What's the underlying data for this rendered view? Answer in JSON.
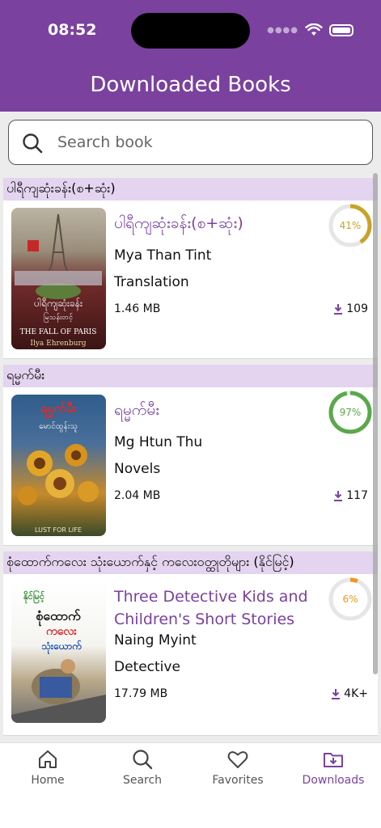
{
  "status": {
    "time": "08:52"
  },
  "header": {
    "title": "Downloaded Books"
  },
  "search": {
    "placeholder": "Search book"
  },
  "books": [
    {
      "section": "ပါရီကျဆုံးခန်း(စ+ဆုံး)",
      "title": "ပါရီကျဆုံးခန်း(စ+ဆုံး)",
      "author": "Mya Than Tint",
      "category": "Translation",
      "size": "1.46 MB",
      "downloads": "109",
      "progress_label": "41%",
      "progress": 41,
      "ring_color": "#c9a227",
      "cover_text_top": "ပါရီကျဆုံးခန်း",
      "cover_text_sub": "မြသန်းတင့်",
      "cover_text_en": "THE FALL OF PARIS",
      "cover_text_author": "Ilya Ehrenburg"
    },
    {
      "section": "ရမ္မက်မီး",
      "title": "ရမ္မက်မီး",
      "author": "Mg Htun Thu",
      "category": "Novels",
      "size": "2.04 MB",
      "downloads": "117",
      "progress_label": "97%",
      "progress": 97,
      "ring_color": "#5aa84a",
      "cover_text_top": "ရမ္မက်မီး",
      "cover_text_sub": "မောင်ထွန်းသူ",
      "cover_text_en": "LUST FOR LIFE"
    },
    {
      "section": "စုံထောက်ကလေး သုံးယောက်နှင့် ကလေးဝတ္ထုတိုများ (နိုင်မြင့်)",
      "title": "Three Detective Kids and Children's Short Stories",
      "author": "Naing Myint",
      "category": "Detective",
      "size": "17.79 MB",
      "downloads": "4K+",
      "progress_label": "6%",
      "progress": 6,
      "ring_color": "#f0961e",
      "cover_text_top": "စုံထောက်",
      "cover_text_sub": "ကလေး",
      "cover_text_en": "သုံးယောက်"
    }
  ],
  "tabs": [
    {
      "label": "Home",
      "icon": "home-icon",
      "active": false
    },
    {
      "label": "Search",
      "icon": "search-icon",
      "active": false
    },
    {
      "label": "Favorites",
      "icon": "heart-icon",
      "active": false
    },
    {
      "label": "Downloads",
      "icon": "downloads-folder-icon",
      "active": true
    }
  ],
  "colors": {
    "brand": "#7a429e",
    "section_bg": "#e4d4ef"
  }
}
